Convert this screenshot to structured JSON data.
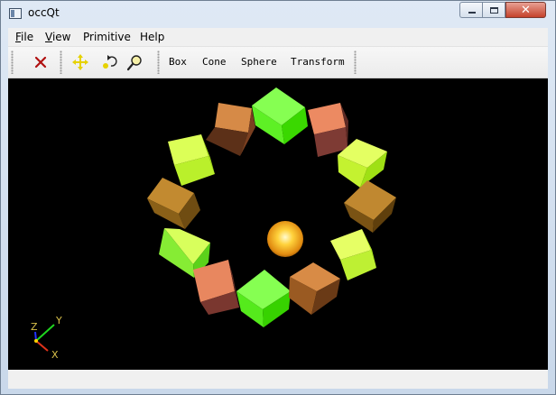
{
  "window": {
    "title": "occQt"
  },
  "menubar": {
    "items": [
      {
        "mnemonic": "F",
        "rest": "ile"
      },
      {
        "mnemonic": "V",
        "rest": "iew"
      },
      {
        "mnemonic": "",
        "rest": "Primitive"
      },
      {
        "mnemonic": "",
        "rest": "Help"
      }
    ]
  },
  "toolbar": {
    "icons": [
      "close-x-icon",
      "pan-icon",
      "rotate-icon",
      "zoom-icon"
    ],
    "text_buttons": [
      "Box",
      "Cone",
      "Sphere",
      "Transform"
    ]
  },
  "viewport": {
    "background": "#000000",
    "colors": {
      "green_bright": "#66ff33",
      "yellow_green": "#ddff44",
      "brown": "#b8862d",
      "orange_salmon": "#e8865c",
      "sphere": "#ffcc33"
    },
    "axes": {
      "x": "X",
      "y": "Y",
      "z": "Z"
    }
  }
}
